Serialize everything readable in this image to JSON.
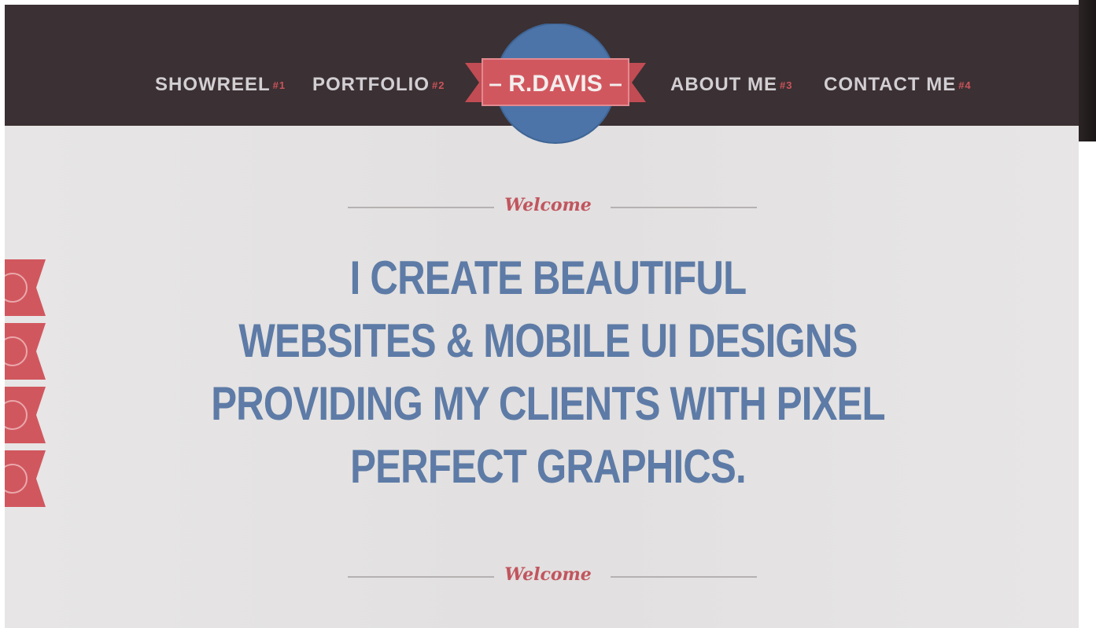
{
  "nav": {
    "items": [
      {
        "label": "SHOWREEL",
        "num": "#1"
      },
      {
        "label": "PORTFOLIO",
        "num": "#2"
      },
      {
        "label": "ABOUT ME",
        "num": "#3"
      },
      {
        "label": "CONTACT ME",
        "num": "#4"
      }
    ],
    "logo": "– R.DAVIS –"
  },
  "welcome_top": "Welcome",
  "welcome_bottom": "Welcome",
  "headline": {
    "lines": [
      "I CREATE BEAUTIFUL",
      "WEBSITES & MOBILE UI DESIGNS",
      "PROVIDING MY CLIENTS WITH PIXEL",
      "PERFECT GRAPHICS."
    ]
  },
  "colors": {
    "nav_bg": "#3b3033",
    "accent_red": "#d1575e",
    "logo_blue": "#4d74a8",
    "headline_blue": "#5d7ba6",
    "page_bg": "#e6e4e4"
  },
  "side_ribbons": [
    "ribbon-icon",
    "ribbon-icon",
    "ribbon-icon",
    "ribbon-icon"
  ]
}
